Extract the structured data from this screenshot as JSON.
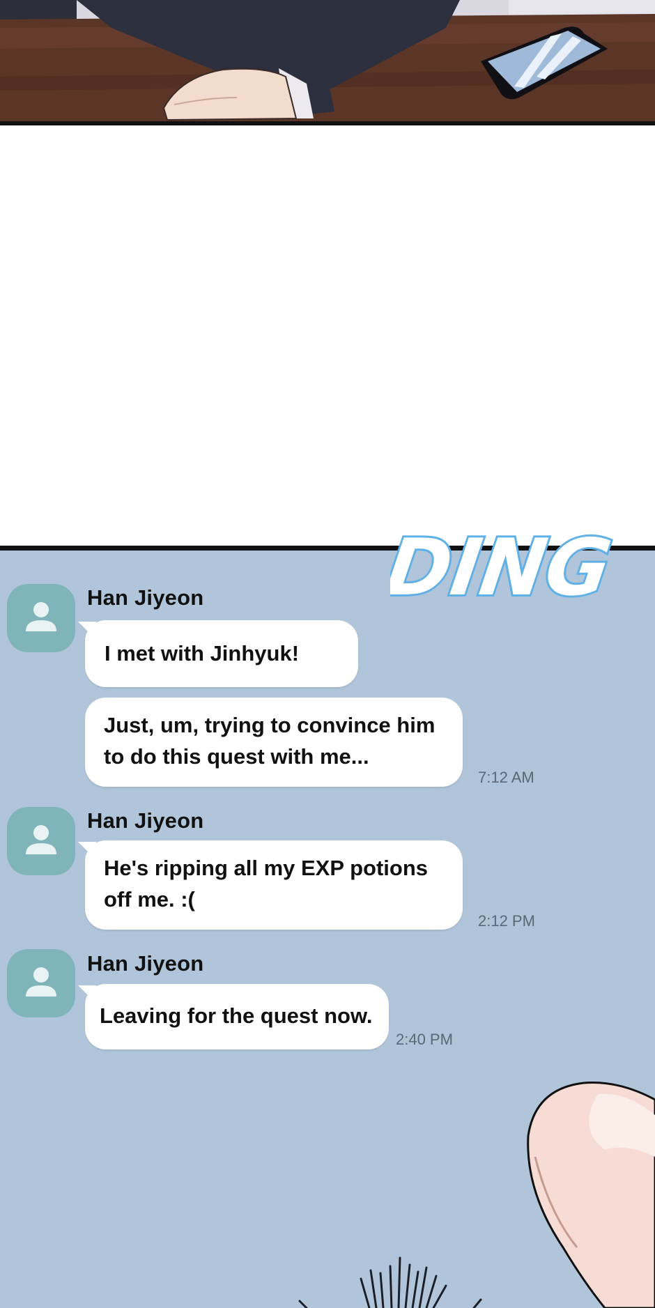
{
  "sfx": {
    "text": "DING"
  },
  "messages": [
    {
      "sender": "Han Jiyeon",
      "lines": [
        "I met with Jinhyuk!"
      ],
      "time": ""
    },
    {
      "sender": "",
      "lines": [
        "Just, um, trying to convince him",
        "to do this quest with me..."
      ],
      "time": "7:12 AM"
    },
    {
      "sender": "Han Jiyeon",
      "lines": [
        "He's ripping all my EXP potions",
        "off me. :("
      ],
      "time": "2:12 PM"
    },
    {
      "sender": "Han Jiyeon",
      "lines": [
        "Leaving for the quest now."
      ],
      "time": "2:40 PM"
    }
  ],
  "colors": {
    "chat_background": "#b0c5da",
    "avatar": "#7fb4b8",
    "bubble": "#ffffff",
    "desk": "#5b3526",
    "sfx_outline": "#5fb0e6"
  },
  "icons": {
    "avatar": "person-icon",
    "phone": "phone-icon"
  }
}
